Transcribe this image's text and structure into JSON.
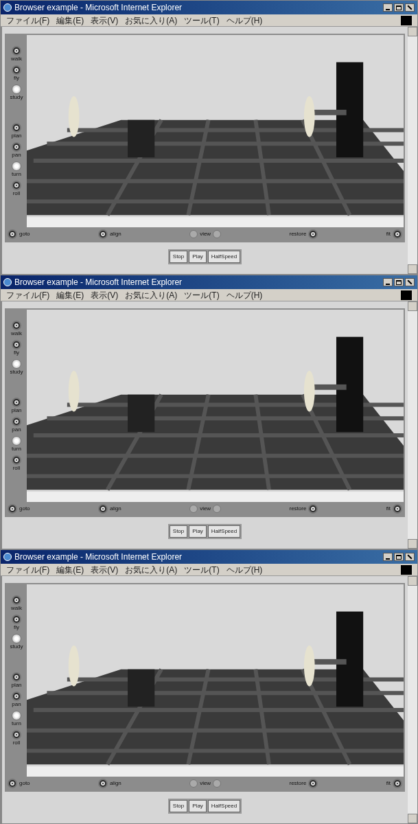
{
  "windows": [
    {
      "title": "Browser example - Microsoft Internet Explorer",
      "menu": [
        "ファイル(F)",
        "編集(E)",
        "表示(V)",
        "お気に入り(A)",
        "ツール(T)",
        "ヘルプ(H)"
      ],
      "side_controls": [
        {
          "label": "walk",
          "lit": false
        },
        {
          "label": "fly",
          "lit": false
        },
        {
          "label": "study",
          "lit": true
        },
        {
          "label": "plan",
          "lit": false
        },
        {
          "label": "pan",
          "lit": false
        },
        {
          "label": "turn",
          "lit": true
        },
        {
          "label": "roll",
          "lit": false
        }
      ],
      "bottom_controls": [
        {
          "label": "goto",
          "kind": "icon-left"
        },
        {
          "label": "align",
          "kind": "icon-left"
        },
        {
          "label": "view",
          "kind": "arrows"
        },
        {
          "label": "restore",
          "kind": "icon-right"
        },
        {
          "label": "fit",
          "kind": "icon-right"
        }
      ],
      "buttons": [
        "Stop",
        "Play",
        "HalfSpeed"
      ]
    },
    {
      "title": "Browser example - Microsoft Internet Explorer",
      "menu": [
        "ファイル(F)",
        "編集(E)",
        "表示(V)",
        "お気に入り(A)",
        "ツール(T)",
        "ヘルプ(H)"
      ],
      "side_controls": [
        {
          "label": "walk",
          "lit": false
        },
        {
          "label": "fly",
          "lit": false
        },
        {
          "label": "study",
          "lit": true
        },
        {
          "label": "plan",
          "lit": false
        },
        {
          "label": "pan",
          "lit": false
        },
        {
          "label": "turn",
          "lit": true
        },
        {
          "label": "roll",
          "lit": false
        }
      ],
      "bottom_controls": [
        {
          "label": "goto",
          "kind": "icon-left"
        },
        {
          "label": "align",
          "kind": "icon-left"
        },
        {
          "label": "view",
          "kind": "arrows"
        },
        {
          "label": "restore",
          "kind": "icon-right"
        },
        {
          "label": "fit",
          "kind": "icon-right"
        }
      ],
      "buttons": [
        "Stop",
        "Play",
        "HalfSpeed"
      ]
    },
    {
      "title": "Browser example - Microsoft Internet Explorer",
      "menu": [
        "ファイル(F)",
        "編集(E)",
        "表示(V)",
        "お気に入り(A)",
        "ツール(T)",
        "ヘルプ(H)"
      ],
      "side_controls": [
        {
          "label": "walk",
          "lit": false
        },
        {
          "label": "fly",
          "lit": false
        },
        {
          "label": "study",
          "lit": true
        },
        {
          "label": "plan",
          "lit": false
        },
        {
          "label": "pan",
          "lit": false
        },
        {
          "label": "turn",
          "lit": true
        },
        {
          "label": "roll",
          "lit": false
        }
      ],
      "bottom_controls": [
        {
          "label": "goto",
          "kind": "icon-left"
        },
        {
          "label": "align",
          "kind": "icon-left"
        },
        {
          "label": "view",
          "kind": "arrows"
        },
        {
          "label": "restore",
          "kind": "icon-right"
        },
        {
          "label": "fit",
          "kind": "icon-right"
        }
      ],
      "buttons": [
        "Stop",
        "Play",
        "HalfSpeed"
      ]
    }
  ]
}
